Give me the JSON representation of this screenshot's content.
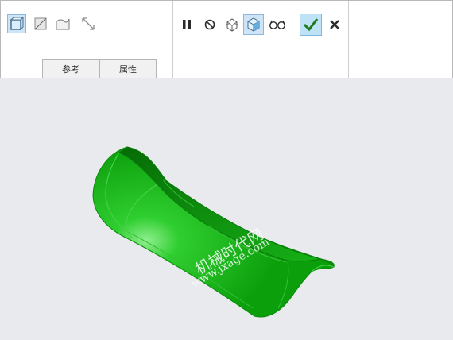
{
  "toolbar": {
    "left_tools": [
      {
        "icon": "solid-surface-icon",
        "active": true
      },
      {
        "icon": "plane-surface-icon",
        "active": false
      },
      {
        "icon": "curved-surface-icon",
        "active": false
      },
      {
        "icon": "expand-arrows-icon",
        "active": false
      }
    ],
    "mid_tools": [
      {
        "icon": "pause-icon"
      },
      {
        "icon": "no-preview-icon"
      },
      {
        "icon": "wireframe-preview-icon"
      },
      {
        "icon": "shaded-preview-icon",
        "active": true
      },
      {
        "icon": "glasses-view-icon"
      }
    ],
    "confirm_icon": "checkmark-icon",
    "cancel_icon": "close-icon"
  },
  "tabs": [
    {
      "label": "参考"
    },
    {
      "label": "属性"
    }
  ],
  "watermark": {
    "line1": "机械时代网",
    "line2": "www.jxage.com"
  },
  "colors": {
    "model_green": "#11b311",
    "model_dark": "#0a7a0a",
    "viewport_bg": "#e8eaed",
    "confirm_check": "#1f7a1f"
  }
}
